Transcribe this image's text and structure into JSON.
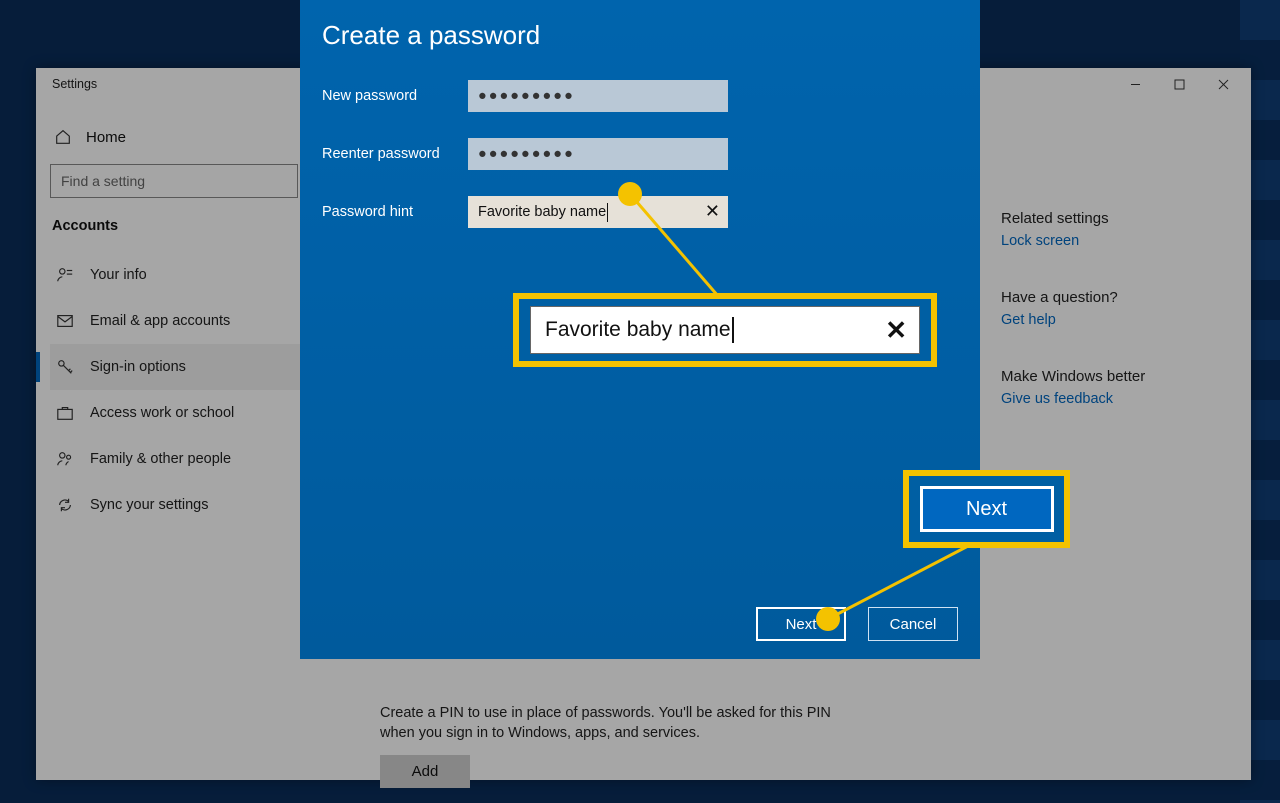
{
  "settings": {
    "window_title": "Settings",
    "home_label": "Home",
    "search_placeholder": "Find a setting",
    "section_title": "Accounts",
    "nav": [
      {
        "id": "your-info",
        "label": "Your info"
      },
      {
        "id": "email-accounts",
        "label": "Email & app accounts"
      },
      {
        "id": "signin-options",
        "label": "Sign-in options",
        "active": true
      },
      {
        "id": "access-work-school",
        "label": "Access work or school"
      },
      {
        "id": "family-people",
        "label": "Family & other people"
      },
      {
        "id": "sync-settings",
        "label": "Sync your settings"
      }
    ],
    "right": {
      "related_heading": "Related settings",
      "related_link": "Lock screen",
      "question_heading": "Have a question?",
      "question_link": "Get help",
      "better_heading": "Make Windows better",
      "better_link": "Give us feedback"
    },
    "pin_text": "Create a PIN to use in place of passwords. You'll be asked for this PIN when you sign in to Windows, apps, and services.",
    "add_label": "Add"
  },
  "dialog": {
    "title": "Create a password",
    "new_pw_label": "New password",
    "new_pw_value": "●●●●●●●●●",
    "reenter_label": "Reenter password",
    "reenter_value": "●●●●●●●●●",
    "hint_label": "Password hint",
    "hint_value": "Favorite baby name",
    "next_label": "Next",
    "cancel_label": "Cancel"
  },
  "callouts": {
    "hint_zoom": "Favorite baby name",
    "next_zoom": "Next"
  }
}
